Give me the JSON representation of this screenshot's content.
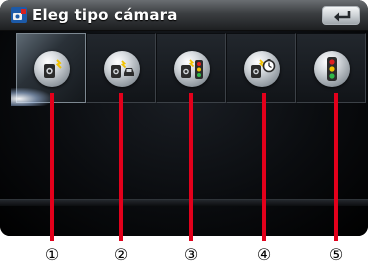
{
  "window": {
    "title": "Eleg tipo cámara",
    "title_icon": "camera-settings-icon",
    "back_icon": "back-return-icon"
  },
  "options": [
    {
      "icon": "fixed-speed-camera-icon",
      "selected": true
    },
    {
      "icon": "vehicle-speed-camera-icon",
      "selected": false
    },
    {
      "icon": "traffic-light-camera-icon",
      "selected": false
    },
    {
      "icon": "average-speed-camera-icon",
      "selected": false
    },
    {
      "icon": "traffic-light-icon",
      "selected": false
    }
  ],
  "callouts": [
    "①",
    "②",
    "③",
    "④",
    "⑤"
  ],
  "colors": {
    "callout_line": "#e3001b",
    "camera_body": "#2b2b2b",
    "flash": "#f2c200"
  }
}
